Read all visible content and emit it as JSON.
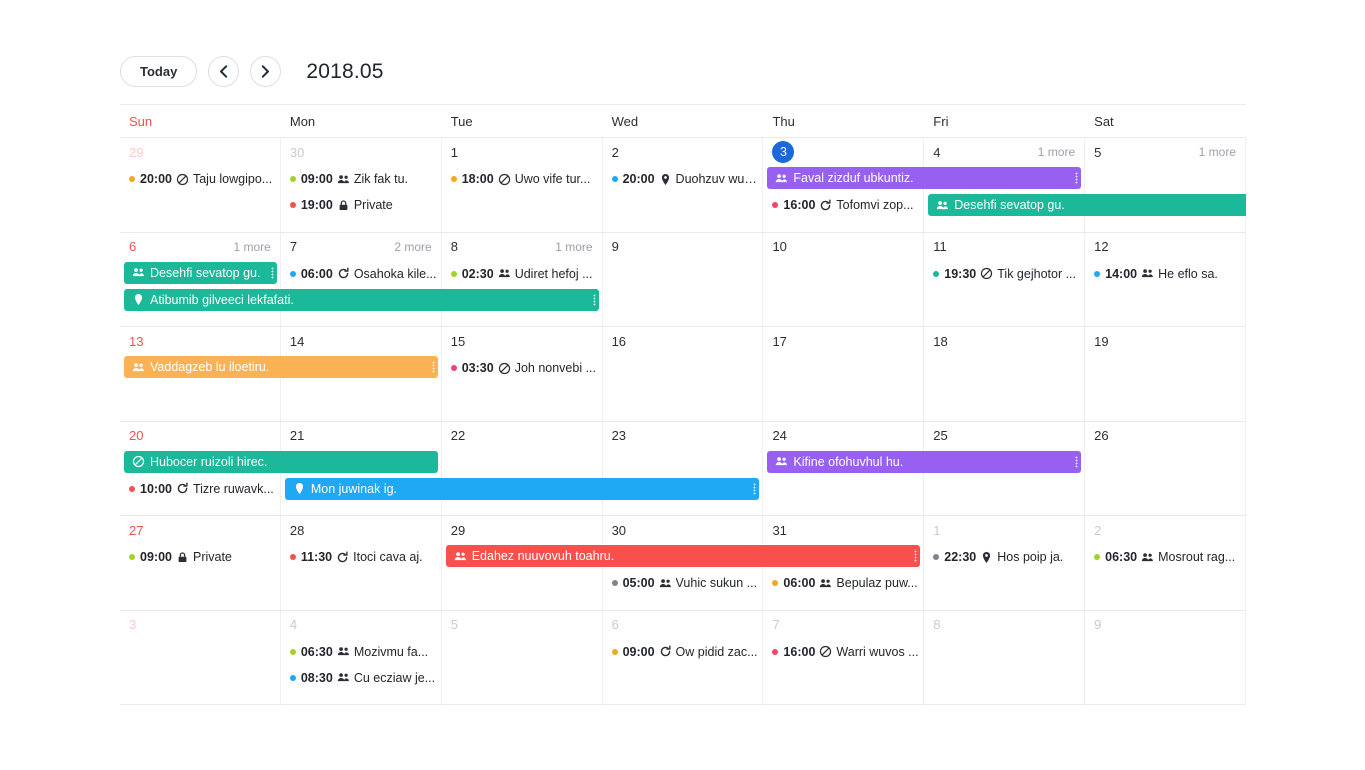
{
  "toolbar": {
    "today_label": "Today",
    "prev_icon": "chevron-left-icon",
    "next_icon": "chevron-right-icon",
    "title": "2018.05"
  },
  "weekdays": [
    "Sun",
    "Mon",
    "Tue",
    "Wed",
    "Thu",
    "Fri",
    "Sat"
  ],
  "colors": {
    "today_badge": "#1a68d9",
    "sunday": "#f3514f",
    "purple": "#9860f0",
    "teal": "#1bb99a",
    "orange": "#fbb254",
    "blue": "#1fa9f4",
    "red": "#f9504d",
    "dot_orange": "#f5a623",
    "dot_green": "#9fd427",
    "dot_red": "#f3514f",
    "dot_blue": "#1fa9f4",
    "dot_teal": "#1bb99a",
    "dot_pink": "#f5436b",
    "dot_gray": "#7d848d"
  },
  "more_label_1": "1 more",
  "more_label_2": "2 more",
  "weeks": [
    {
      "days": [
        {
          "num": "29",
          "other": true,
          "sun": true
        },
        {
          "num": "30",
          "other": true
        },
        {
          "num": "1"
        },
        {
          "num": "2"
        },
        {
          "num": "3",
          "today": true
        },
        {
          "num": "4",
          "more": "1 more"
        },
        {
          "num": "5",
          "more": "1 more"
        }
      ],
      "timed": [
        {
          "col": 0,
          "slot": 0,
          "dot": "dot_orange",
          "time": "20:00",
          "icon": "ban-icon",
          "text": "Taju lowgipo..."
        },
        {
          "col": 1,
          "slot": 0,
          "dot": "dot_green",
          "time": "09:00",
          "icon": "people-icon",
          "text": "Zik fak tu."
        },
        {
          "col": 1,
          "slot": 1,
          "dot": "dot_red",
          "time": "19:00",
          "icon": "lock-icon",
          "text": "Private"
        },
        {
          "col": 2,
          "slot": 0,
          "dot": "dot_orange",
          "time": "18:00",
          "icon": "ban-icon",
          "text": "Uwo vife tur..."
        },
        {
          "col": 3,
          "slot": 0,
          "dot": "dot_blue",
          "time": "20:00",
          "icon": "pin-icon",
          "text": "Duohzuv wua..."
        },
        {
          "col": 4,
          "slot": 1,
          "dot": "dot_pink",
          "time": "16:00",
          "icon": "repeat-icon",
          "text": "Tofomvi zop..."
        }
      ],
      "blocks": [
        {
          "start": 4,
          "end": 6,
          "slot": 0,
          "color": "purple",
          "icon": "people-icon",
          "text": "Faval zizduf ubkuntiz.",
          "grip": true,
          "bleed": false
        },
        {
          "start": 5,
          "end": 7,
          "slot": 1,
          "color": "teal",
          "icon": "people-icon",
          "text": "Desehfi sevatop gu.",
          "grip": false,
          "bleed": true
        }
      ]
    },
    {
      "days": [
        {
          "num": "6",
          "sun": true,
          "more": "1 more"
        },
        {
          "num": "7",
          "more": "2 more"
        },
        {
          "num": "8",
          "more": "1 more"
        },
        {
          "num": "9"
        },
        {
          "num": "10"
        },
        {
          "num": "11"
        },
        {
          "num": "12"
        }
      ],
      "timed": [
        {
          "col": 1,
          "slot": 0,
          "dot": "dot_blue",
          "time": "06:00",
          "icon": "repeat-icon",
          "text": "Osahoka kile..."
        },
        {
          "col": 2,
          "slot": 0,
          "dot": "dot_green",
          "time": "02:30",
          "icon": "people-icon",
          "text": "Udiret hefoj ..."
        },
        {
          "col": 5,
          "slot": 0,
          "dot": "dot_teal",
          "time": "19:30",
          "icon": "ban-icon",
          "text": "Tik gejhotor ..."
        },
        {
          "col": 6,
          "slot": 0,
          "dot": "dot_blue",
          "time": "14:00",
          "icon": "people-icon",
          "text": "He eflo sa."
        }
      ],
      "blocks": [
        {
          "start": 0,
          "end": 1,
          "slot": 0,
          "color": "teal",
          "icon": "people-icon",
          "text": "Desehfi sevatop gu.",
          "grip": true,
          "bleed": false
        },
        {
          "start": 0,
          "end": 3,
          "slot": 1,
          "color": "teal",
          "icon": "pin-icon",
          "text": "Atibumib gilveeci lekfafati.",
          "grip": true,
          "bleed": false
        }
      ]
    },
    {
      "days": [
        {
          "num": "13",
          "sun": true
        },
        {
          "num": "14"
        },
        {
          "num": "15"
        },
        {
          "num": "16"
        },
        {
          "num": "17"
        },
        {
          "num": "18"
        },
        {
          "num": "19"
        }
      ],
      "timed": [
        {
          "col": 2,
          "slot": 0,
          "dot": "dot_pink",
          "time": "03:30",
          "icon": "ban-icon",
          "text": "Joh nonvebi ..."
        }
      ],
      "blocks": [
        {
          "start": 0,
          "end": 2,
          "slot": 0,
          "color": "orange",
          "icon": "people-icon",
          "text": "Vaddagzeb lu iloetiru.",
          "grip": true,
          "bleed": false
        }
      ]
    },
    {
      "days": [
        {
          "num": "20",
          "sun": true
        },
        {
          "num": "21"
        },
        {
          "num": "22"
        },
        {
          "num": "23"
        },
        {
          "num": "24"
        },
        {
          "num": "25"
        },
        {
          "num": "26"
        }
      ],
      "timed": [
        {
          "col": 0,
          "slot": 1,
          "dot": "dot_red",
          "time": "10:00",
          "icon": "repeat-icon",
          "text": "Tizre ruwavk..."
        }
      ],
      "blocks": [
        {
          "start": 0,
          "end": 2,
          "slot": 0,
          "color": "teal",
          "icon": "ban-icon",
          "text": "Hubocer ruizoli hirec.",
          "grip": false,
          "bleed": false
        },
        {
          "start": 1,
          "end": 4,
          "slot": 1,
          "color": "blue",
          "icon": "pin-icon",
          "text": "Mon juwinak ig.",
          "grip": true,
          "bleed": false
        },
        {
          "start": 4,
          "end": 6,
          "slot": 0,
          "color": "purple",
          "icon": "people-icon",
          "text": "Kifine ofohuvhul hu.",
          "grip": true,
          "bleed": false
        }
      ]
    },
    {
      "days": [
        {
          "num": "27",
          "sun": true
        },
        {
          "num": "28"
        },
        {
          "num": "29"
        },
        {
          "num": "30"
        },
        {
          "num": "31"
        },
        {
          "num": "1",
          "other": true
        },
        {
          "num": "2",
          "other": true
        }
      ],
      "timed": [
        {
          "col": 0,
          "slot": 0,
          "dot": "dot_green",
          "time": "09:00",
          "icon": "lock-icon",
          "text": "Private"
        },
        {
          "col": 1,
          "slot": 0,
          "dot": "dot_red",
          "time": "11:30",
          "icon": "repeat-icon",
          "text": "Itoci cava aj."
        },
        {
          "col": 3,
          "slot": 1,
          "dot": "dot_gray",
          "time": "05:00",
          "icon": "people-icon",
          "text": "Vuhic sukun ..."
        },
        {
          "col": 4,
          "slot": 1,
          "dot": "dot_orange",
          "time": "06:00",
          "icon": "people-icon",
          "text": "Bepulaz puw..."
        },
        {
          "col": 5,
          "slot": 0,
          "dot": "dot_gray",
          "time": "22:30",
          "icon": "pin-icon",
          "text": "Hos poip ja."
        },
        {
          "col": 6,
          "slot": 0,
          "dot": "dot_green",
          "time": "06:30",
          "icon": "people-icon",
          "text": "Mosrout rag..."
        }
      ],
      "blocks": [
        {
          "start": 2,
          "end": 5,
          "slot": 0,
          "color": "red",
          "icon": "people-icon",
          "text": "Edahez nuuvovuh toahru.",
          "grip": true,
          "bleed": false
        }
      ]
    },
    {
      "days": [
        {
          "num": "3",
          "other": true,
          "sun": true
        },
        {
          "num": "4",
          "other": true
        },
        {
          "num": "5",
          "other": true
        },
        {
          "num": "6",
          "other": true
        },
        {
          "num": "7",
          "other": true
        },
        {
          "num": "8",
          "other": true
        },
        {
          "num": "9",
          "other": true
        }
      ],
      "timed": [
        {
          "col": 1,
          "slot": 0,
          "dot": "dot_green",
          "time": "06:30",
          "icon": "people-icon",
          "text": "Mozivmu fa..."
        },
        {
          "col": 1,
          "slot": 1,
          "dot": "dot_blue",
          "time": "08:30",
          "icon": "people-icon",
          "text": "Cu ecziaw je..."
        },
        {
          "col": 3,
          "slot": 0,
          "dot": "dot_orange",
          "time": "09:00",
          "icon": "repeat-icon",
          "text": "Ow pidid zac..."
        },
        {
          "col": 4,
          "slot": 0,
          "dot": "dot_pink",
          "time": "16:00",
          "icon": "ban-icon",
          "text": "Warri wuvos ..."
        }
      ],
      "blocks": []
    }
  ]
}
